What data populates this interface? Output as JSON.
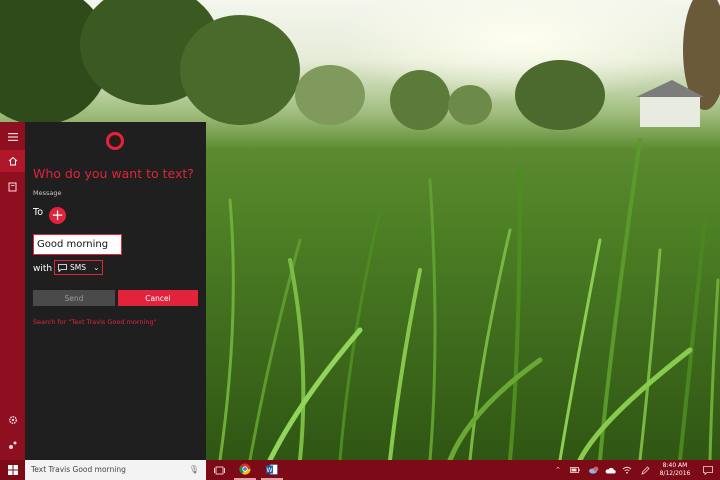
{
  "cortana": {
    "title": "Who do you want to text?",
    "message_label": "Message",
    "to_label": "To",
    "message_value": "Good morning",
    "with_label": "with",
    "channel": "SMS",
    "send_label": "Send",
    "cancel_label": "Cancel",
    "search_link": "Search for \"Text Travis Good morning\"",
    "accent": "#e2233c"
  },
  "sidebar": {
    "items": [
      {
        "icon": "hamburger-menu-icon"
      },
      {
        "icon": "home-icon"
      },
      {
        "icon": "notebook-icon"
      },
      {
        "icon": "gear-icon"
      },
      {
        "icon": "feedback-icon"
      }
    ]
  },
  "taskbar": {
    "search_text": "Text Travis Good morning",
    "apps": [
      {
        "icon": "task-view-icon"
      },
      {
        "icon": "chrome-icon"
      },
      {
        "icon": "word-icon"
      }
    ],
    "tray_icons": [
      "chevron-up-icon",
      "battery-icon",
      "cloud-sync-icon",
      "onedrive-icon",
      "wifi-icon",
      "pen-icon"
    ],
    "time": "8:40 AM",
    "date": "8/12/2016",
    "color": "#7d0a17"
  }
}
